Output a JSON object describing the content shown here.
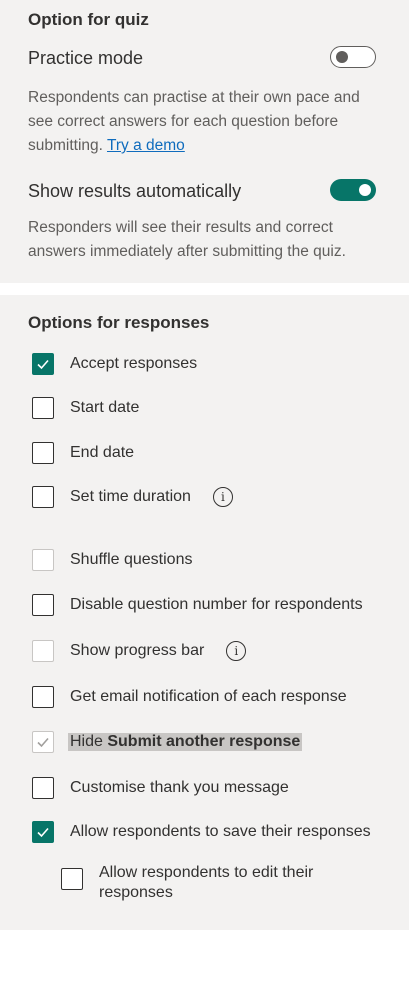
{
  "quiz": {
    "title": "Option for quiz",
    "practice_mode": {
      "label": "Practice mode",
      "on": false,
      "description": "Respondents can practise at their own pace and see correct answers for each question before submitting.",
      "link": "Try a demo"
    },
    "show_results": {
      "label": "Show results automatically",
      "on": true,
      "description": "Responders will see their results and correct answers immediately after submitting the quiz."
    }
  },
  "responses": {
    "title": "Options for responses",
    "options": [
      {
        "label": "Accept responses",
        "checked": true
      },
      {
        "label": "Start date",
        "checked": false
      },
      {
        "label": "End date",
        "checked": false
      },
      {
        "label": "Set time duration",
        "checked": false,
        "info": true
      },
      {
        "label": "Shuffle questions",
        "checked": false,
        "disabled": true
      },
      {
        "label": "Disable question number for respondents",
        "checked": false
      },
      {
        "label": "Show progress bar",
        "checked": false,
        "disabled": true,
        "info": true
      },
      {
        "label": "Get email notification of each response",
        "checked": false
      },
      {
        "label_prefix": "Hide ",
        "label_bold": "Submit another response",
        "checked": true,
        "disabled": true,
        "highlighted": true
      },
      {
        "label": "Customise thank you message",
        "checked": false
      },
      {
        "label": "Allow respondents to save their responses",
        "checked": true
      },
      {
        "label": "Allow respondents to edit their responses",
        "checked": false,
        "indented": true
      }
    ]
  },
  "colors": {
    "accent": "#077568",
    "panel_bg": "#f3f2f1",
    "link": "#0f6cbd",
    "highlight": "#c8c6c4"
  }
}
